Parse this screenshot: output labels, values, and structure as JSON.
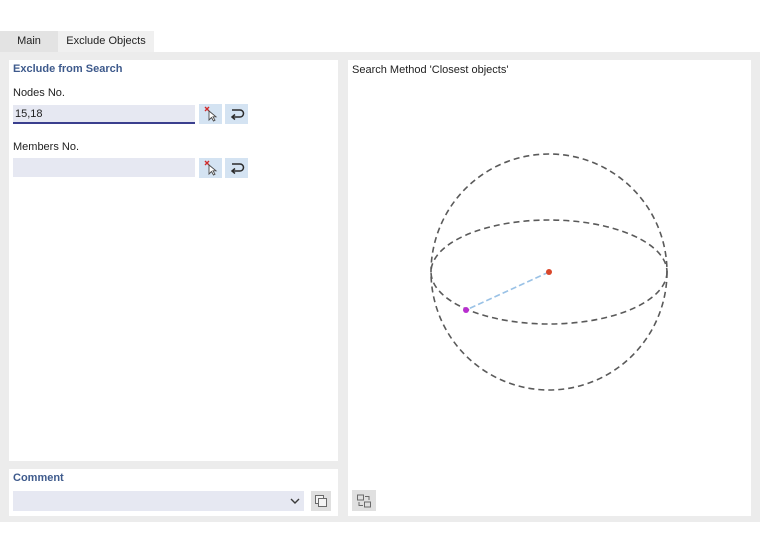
{
  "tabs": [
    {
      "label": "Main",
      "active": false
    },
    {
      "label": "Exclude Objects",
      "active": true
    }
  ],
  "exclude": {
    "section_title": "Exclude from Search",
    "nodes_label": "Nodes No.",
    "nodes_value": "15,18",
    "members_label": "Members No.",
    "members_value": ""
  },
  "comment": {
    "section_title": "Comment",
    "value": ""
  },
  "diagram": {
    "title": "Search Method 'Closest objects'",
    "sphere_color": "#5a5a5a",
    "center_point_color": "#d9472b",
    "target_point_color": "#b82fcf",
    "connector_color": "#9ac2e6"
  },
  "icons": {
    "select_pick": "select-pointer-icon",
    "reset": "undo-arrow-icon",
    "dropdown": "chevron-down-icon",
    "copy": "copy-icon",
    "swap": "swap-icon"
  }
}
